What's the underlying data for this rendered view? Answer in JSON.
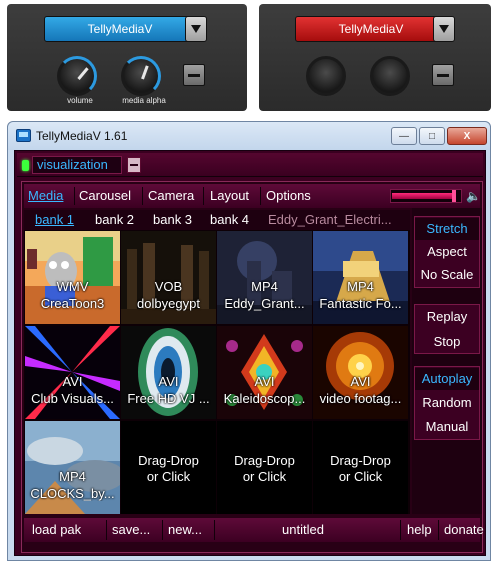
{
  "plugin_panels": {
    "left": {
      "dropdown_value": "TellyMediaV",
      "knobs": [
        {
          "label": "volume",
          "value_pct": 70
        },
        {
          "label": "media alpha",
          "value_pct": 60
        }
      ]
    },
    "right": {
      "dropdown_value": "TellyMediaV"
    }
  },
  "window": {
    "title": "TellyMediaV 1.61",
    "controls": {
      "minimize": "—",
      "maximize": "□",
      "close": "X"
    }
  },
  "app": {
    "visualization_label": "visualization",
    "menu": [
      "Media",
      "Carousel",
      "Camera",
      "Layout",
      "Options"
    ],
    "active_menu": "Media",
    "volume_level_pct": 92,
    "banks": [
      "bank 1",
      "bank 2",
      "bank 3",
      "bank 4",
      "Eddy_Grant_Electri..."
    ],
    "active_bank": "bank 1",
    "cells": [
      {
        "format": "WMV",
        "name": "CreaToon3",
        "thumb": "cartoon"
      },
      {
        "format": "VOB",
        "name": "dolbyegypt",
        "thumb": "egypt"
      },
      {
        "format": "MP4",
        "name": "Eddy_Grant...",
        "thumb": "concert",
        "selected": true
      },
      {
        "format": "MP4",
        "name": "Fantastic Fo...",
        "thumb": "fox"
      },
      {
        "format": "AVI",
        "name": "Club Visuals...",
        "thumb": "rays"
      },
      {
        "format": "AVI",
        "name": "Free HD VJ ...",
        "thumb": "tunnel"
      },
      {
        "format": "AVI",
        "name": "Kaleidoscop...",
        "thumb": "kaleido"
      },
      {
        "format": "AVI",
        "name": "video footag...",
        "thumb": "fireworks"
      },
      {
        "format": "MP4",
        "name": "CLOCKS_by...",
        "thumb": "sky"
      },
      {
        "format": "Drag-Drop",
        "name": "or Click",
        "thumb": "empty"
      },
      {
        "format": "Drag-Drop",
        "name": "or Click",
        "thumb": "empty"
      },
      {
        "format": "Drag-Drop",
        "name": "or Click",
        "thumb": "empty"
      }
    ],
    "scale_buttons": [
      "Stretch",
      "Aspect",
      "No Scale"
    ],
    "active_scale": "Stretch",
    "playback_buttons": [
      "Replay",
      "Stop"
    ],
    "mode_buttons": [
      "Autoplay",
      "Random",
      "Manual"
    ],
    "active_mode": "Autoplay",
    "bottom": {
      "load": "load pak",
      "save": "save...",
      "new": "new...",
      "pak_name": "untitled",
      "help": "help",
      "donate": "donate"
    }
  },
  "colors": {
    "accent_blue": "#3ab8ff",
    "app_bg": "#3a0020",
    "selection_red": "#e02020",
    "led_green": "#3cff3c"
  }
}
